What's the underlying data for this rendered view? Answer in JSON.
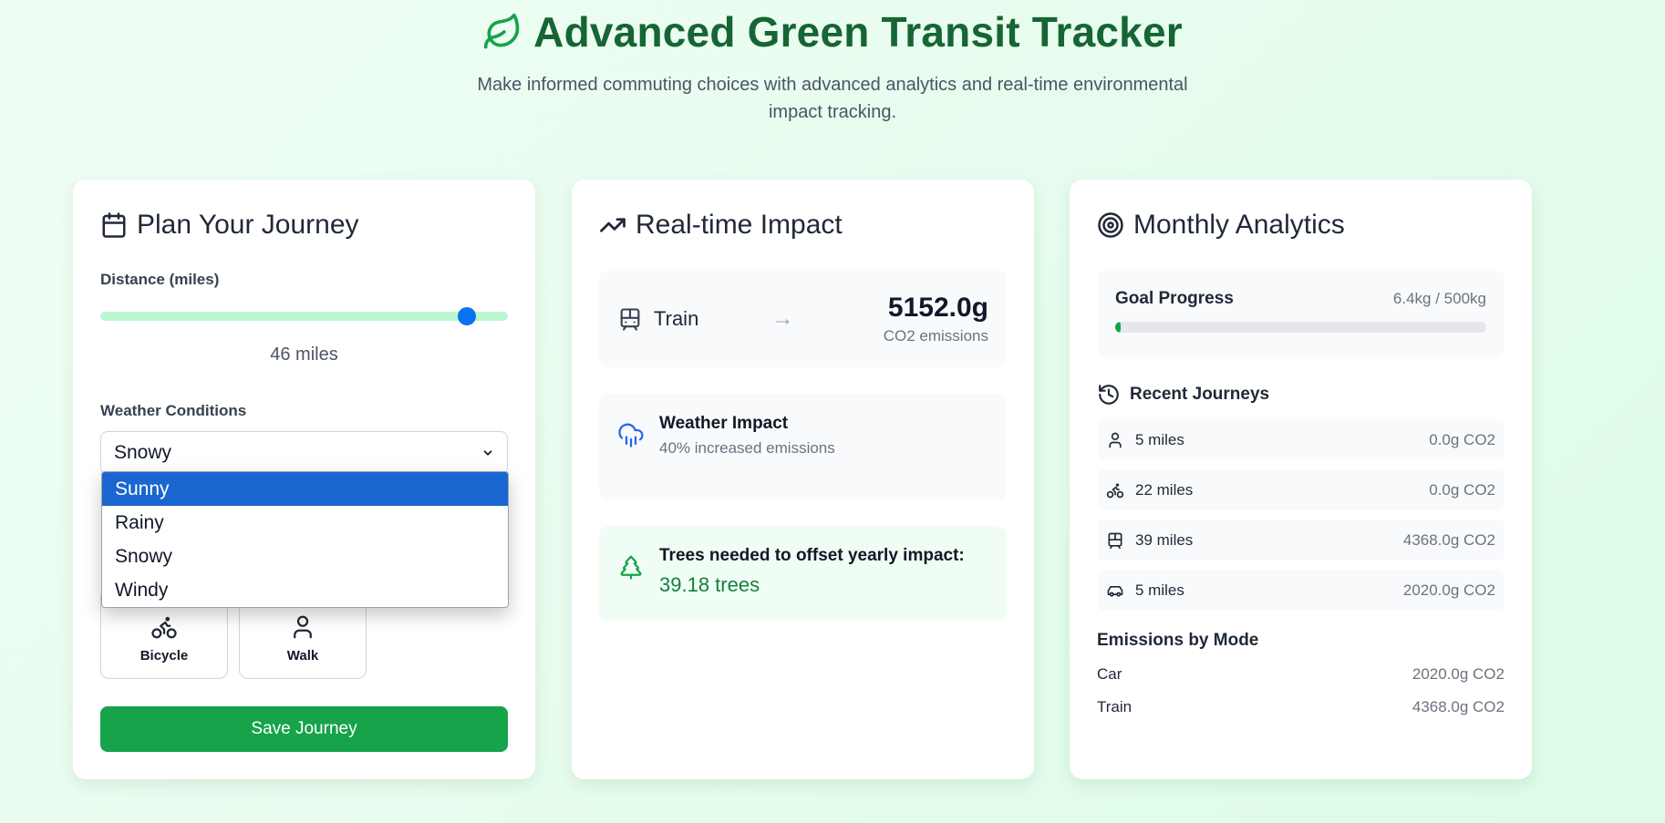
{
  "header": {
    "title": "Advanced Green Transit Tracker",
    "subtitle": "Make informed commuting choices with advanced analytics and real-time environmental impact tracking.",
    "icon": "leaf-icon",
    "accent": "#166534"
  },
  "plan": {
    "title": "Plan Your Journey",
    "distance_label": "Distance (miles)",
    "distance_value": 46,
    "distance_fraction": 0.9,
    "distance_text": "46 miles",
    "weather_label": "Weather Conditions",
    "weather_selected": "Snowy",
    "weather_options": [
      "Sunny",
      "Rainy",
      "Snowy",
      "Windy"
    ],
    "weather_highlighted": "Sunny",
    "modes": [
      {
        "label": "Bicycle",
        "icon": "bicycle-icon"
      },
      {
        "label": "Walk",
        "icon": "walk-icon"
      }
    ],
    "save_label": "Save Journey"
  },
  "impact": {
    "title": "Real-time Impact",
    "mode": "Train",
    "emissions": "5152.0g",
    "emissions_label": "CO2 emissions",
    "weather_title": "Weather Impact",
    "weather_sub": "40% increased emissions",
    "trees_title": "Trees needed to offset yearly impact:",
    "trees_value": "39.18 trees"
  },
  "analytics": {
    "title": "Monthly Analytics",
    "goal_title": "Goal Progress",
    "goal_value": "6.4kg / 500kg",
    "goal_fraction": 0.0128,
    "recent_title": "Recent Journeys",
    "journeys": [
      {
        "icon": "walk-icon",
        "miles": "5 miles",
        "co2": "0.0g CO2"
      },
      {
        "icon": "bicycle-icon",
        "miles": "22 miles",
        "co2": "0.0g CO2"
      },
      {
        "icon": "train-icon",
        "miles": "39 miles",
        "co2": "4368.0g CO2"
      },
      {
        "icon": "car-icon",
        "miles": "5 miles",
        "co2": "2020.0g CO2"
      }
    ],
    "emissions_title": "Emissions by Mode",
    "emissions_by_mode": [
      {
        "mode": "Car",
        "value": "2020.0g CO2"
      },
      {
        "mode": "Train",
        "value": "4368.0g CO2"
      }
    ]
  }
}
